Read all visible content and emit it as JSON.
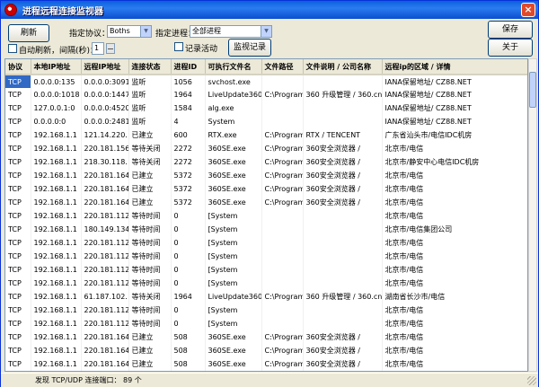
{
  "window": {
    "title": "进程远程连接监视器",
    "close_icon": "×"
  },
  "toolbar": {
    "refresh_label": "刷新",
    "protocol_label": "指定协议：",
    "protocol_value": "Boths",
    "process_label": "指定进程：",
    "process_value": "全部进程",
    "auto_refresh_label": "自动刷新，间隔(秒)：",
    "interval_value": "1",
    "log_label": "记录活动",
    "view_log_label": "监视记录",
    "save_label": "保存",
    "about_label": "关于"
  },
  "table": {
    "columns": [
      "协议",
      "本地IP地址",
      "远程IP地址",
      "连接状态",
      "进程ID",
      "可执行文件名",
      "文件路径",
      "文件说明 / 公司名称",
      "远程ip的区域 / 详情"
    ],
    "rows": [
      [
        "TCP",
        "0.0.0.0:135",
        "0.0.0.0:3091",
        "监听",
        "1056",
        "svchost.exe",
        "",
        "",
        "IANA保留地址/ CZ88.NET"
      ],
      [
        "TCP",
        "0.0.0.0:1018",
        "0.0.0.0:1447",
        "监听",
        "1964",
        "LiveUpdate360.",
        "C:\\Program",
        "360 升级管理 / 360.cn",
        "IANA保留地址/ CZ88.NET"
      ],
      [
        "TCP",
        "127.0.0.1:0",
        "0.0.0.0:4520",
        "监听",
        "1584",
        "alg.exe",
        "",
        "",
        "IANA保留地址/ CZ88.NET"
      ],
      [
        "TCP",
        "0.0.0.0:0",
        "0.0.0.0:2481",
        "监听",
        "4",
        "System",
        "",
        "",
        "IANA保留地址/ CZ88.NET"
      ],
      [
        "TCP",
        "192.168.1.1",
        "121.14.220.",
        "已建立",
        "600",
        "RTX.exe",
        "C:\\Program",
        "RTX / TENCENT",
        "广东省汕头市/电信IDC机房"
      ],
      [
        "TCP",
        "192.168.1.1",
        "220.181.156",
        "等待关闭",
        "2272",
        "360SE.exe",
        "C:\\Program",
        "360安全浏览器 /",
        "北京市/电信"
      ],
      [
        "TCP",
        "192.168.1.1",
        "218.30.118.",
        "等待关闭",
        "2272",
        "360SE.exe",
        "C:\\Program",
        "360安全浏览器 /",
        "北京市/静安中心电信IDC机房"
      ],
      [
        "TCP",
        "192.168.1.1",
        "220.181.164",
        "已建立",
        "5372",
        "360SE.exe",
        "C:\\Program",
        "360安全浏览器 /",
        "北京市/电信"
      ],
      [
        "TCP",
        "192.168.1.1",
        "220.181.164",
        "已建立",
        "5372",
        "360SE.exe",
        "C:\\Program",
        "360安全浏览器 /",
        "北京市/电信"
      ],
      [
        "TCP",
        "192.168.1.1",
        "220.181.164",
        "已建立",
        "5372",
        "360SE.exe",
        "C:\\Program",
        "360安全浏览器 /",
        "北京市/电信"
      ],
      [
        "TCP",
        "192.168.1.1",
        "220.181.112",
        "等待时间",
        "0",
        "[System",
        "",
        "",
        "北京市/电信"
      ],
      [
        "TCP",
        "192.168.1.1",
        "180.149.134",
        "等待时间",
        "0",
        "[System",
        "",
        "",
        "北京市/电信集团公司"
      ],
      [
        "TCP",
        "192.168.1.1",
        "220.181.112",
        "等待时间",
        "0",
        "[System",
        "",
        "",
        "北京市/电信"
      ],
      [
        "TCP",
        "192.168.1.1",
        "220.181.112",
        "等待时间",
        "0",
        "[System",
        "",
        "",
        "北京市/电信"
      ],
      [
        "TCP",
        "192.168.1.1",
        "220.181.112",
        "等待时间",
        "0",
        "[System",
        "",
        "",
        "北京市/电信"
      ],
      [
        "TCP",
        "192.168.1.1",
        "220.181.112",
        "等待时间",
        "0",
        "[System",
        "",
        "",
        "北京市/电信"
      ],
      [
        "TCP",
        "192.168.1.1",
        "61.187.102.",
        "等待关闭",
        "1964",
        "LiveUpdate360.",
        "C:\\Program",
        "360 升级管理 / 360.cn",
        "湖南省长沙市/电信"
      ],
      [
        "TCP",
        "192.168.1.1",
        "220.181.112",
        "等待时间",
        "0",
        "[System",
        "",
        "",
        "北京市/电信"
      ],
      [
        "TCP",
        "192.168.1.1",
        "220.181.112",
        "等待时间",
        "0",
        "[System",
        "",
        "",
        "北京市/电信"
      ],
      [
        "TCP",
        "192.168.1.1",
        "220.181.164",
        "已建立",
        "508",
        "360SE.exe",
        "C:\\Program",
        "360安全浏览器 /",
        "北京市/电信"
      ],
      [
        "TCP",
        "192.168.1.1",
        "220.181.164",
        "已建立",
        "508",
        "360SE.exe",
        "C:\\Program",
        "360安全浏览器 /",
        "北京市/电信"
      ],
      [
        "TCP",
        "192.168.1.1",
        "220.181.164",
        "已建立",
        "508",
        "360SE.exe",
        "C:\\Program",
        "360安全浏览器 /",
        "北京市/电信"
      ]
    ]
  },
  "status": {
    "text": "发现 TCP/UDP 连接端口： 89 个"
  }
}
